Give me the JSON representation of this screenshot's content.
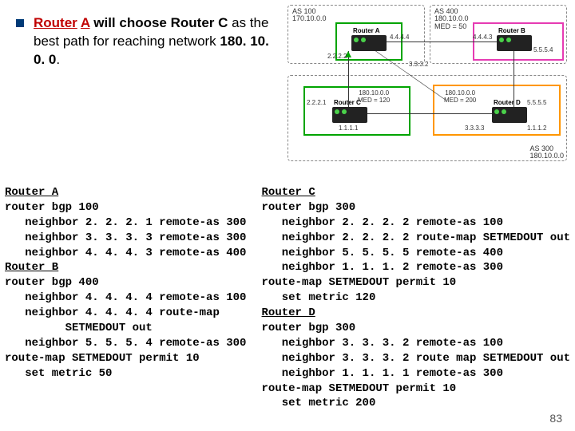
{
  "bullet": {
    "lead1a": "Router",
    "lead1b": "A",
    "lead2": " will choose ",
    "lead3": "Router C",
    "lead4": " as the best path for reaching network ",
    "lead5": "180. 10. 0. 0",
    "lead6": "."
  },
  "diagram": {
    "as100": "AS 100\n170.10.0.0",
    "as400": "AS 400\n180.10.0.0\nMED = 50",
    "as300": "AS 300\n180.10.0.0",
    "ra": "Router A",
    "rb": "Router B",
    "rc": "Router C",
    "rd": "Router D",
    "ip_a_left": "2.2.2.2",
    "ip_a_right": "4.4.4.4",
    "ip_b_left": "4.4.4.3",
    "ip_b_right": "5.5.5.4",
    "ip_c_left": "2.2.2.1",
    "ip_c_midlabel": "180.10.0.0\nMED = 120",
    "ip_c_below": "1.1.1.1",
    "ip_d_midlabel": "180.10.0.0\nMED = 200",
    "ip_d_left": "3.3.3.3",
    "ip_d_right": "5.5.5.5",
    "ip_link_ad": "3.3.3.2",
    "ip_cd": "1.1.1.2"
  },
  "left_col": {
    "h1": "Router A",
    "l1": "router bgp 100",
    "l2": "   neighbor 2. 2. 2. 1 remote-as 300",
    "l3": "   neighbor 3. 3. 3. 3 remote-as 300",
    "l4": "   neighbor 4. 4. 4. 3 remote-as 400",
    "h2": "Router B",
    "l5": "router bgp 400",
    "l6": "   neighbor 4. 4. 4. 4 remote-as 100",
    "l7": "   neighbor 4. 4. 4. 4 route-map",
    "l8": "         SETMEDOUT out",
    "l9": "   neighbor 5. 5. 5. 4 remote-as 300",
    "l10": "route-map SETMEDOUT permit 10",
    "l11": "   set metric 50"
  },
  "right_col": {
    "h1": "Router C",
    "l1": "router bgp 300",
    "l2": "   neighbor 2. 2. 2. 2 remote-as 100",
    "l3": "   neighbor 2. 2. 2. 2 route-map SETMEDOUT out",
    "l4": "   neighbor 5. 5. 5. 5 remote-as 400",
    "l5": "   neighbor 1. 1. 1. 2 remote-as 300",
    "l6": "route-map SETMEDOUT permit 10",
    "l7": "   set metric 120",
    "h2": "Router D",
    "l8": "router bgp 300",
    "l9": "   neighbor 3. 3. 3. 2 remote-as 100",
    "l10": "   neighbor 3. 3. 3. 2 route map SETMEDOUT out",
    "l11": "   neighbor 1. 1. 1. 1 remote-as 300",
    "l12": "route-map SETMEDOUT permit 10",
    "l13": "   set metric 200"
  },
  "page": "83"
}
